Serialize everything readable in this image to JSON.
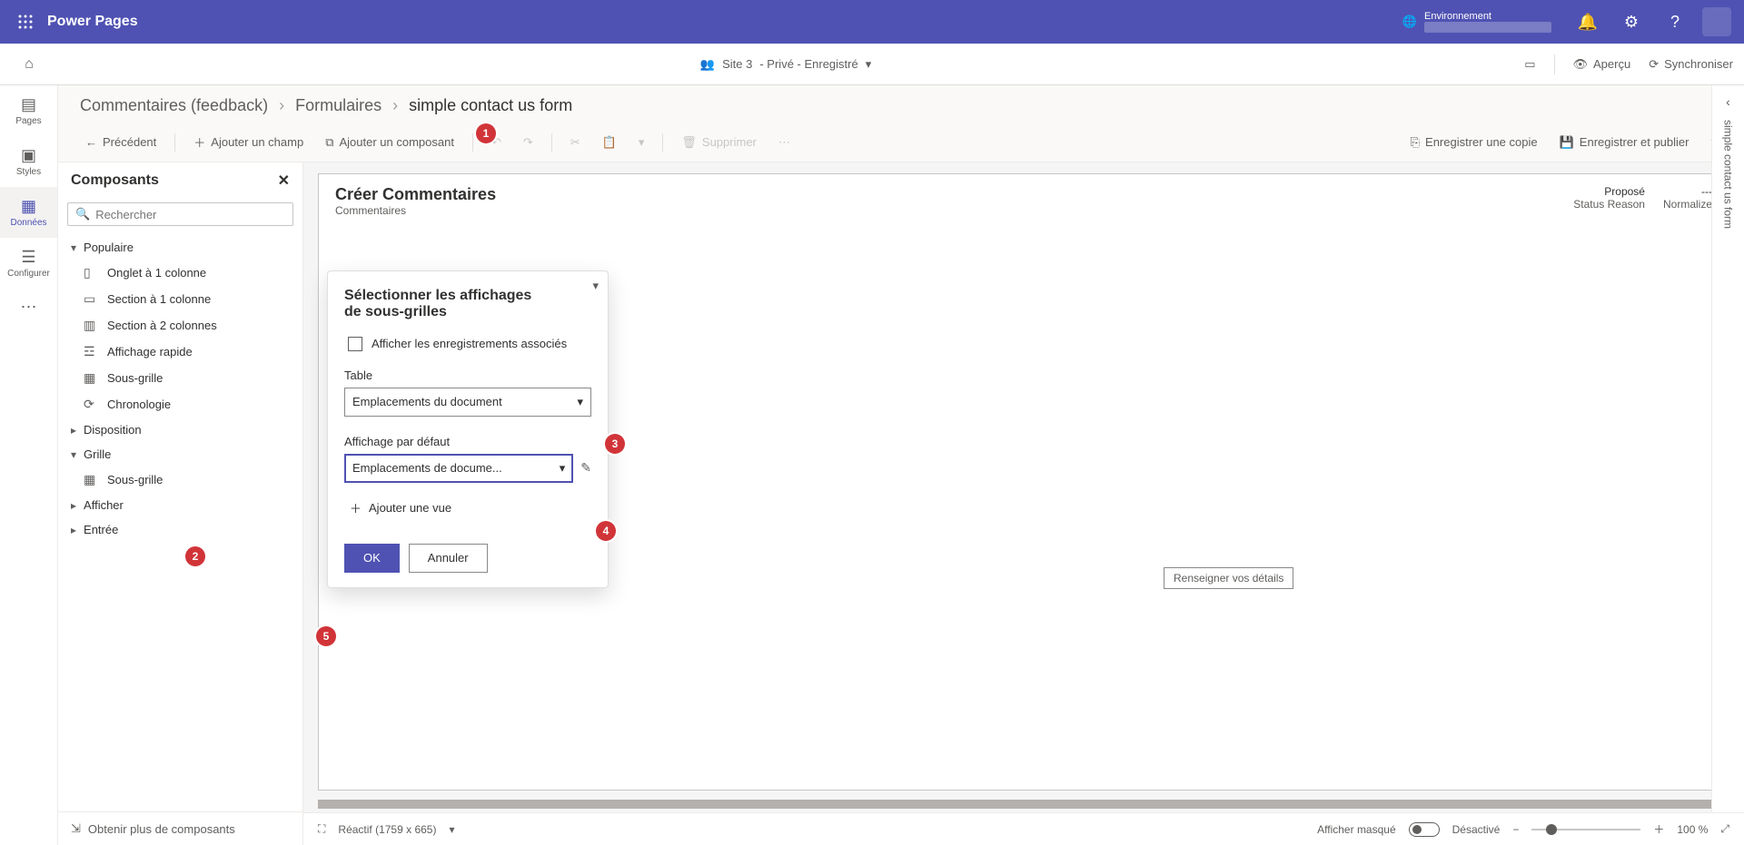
{
  "topbar": {
    "brand": "Power Pages",
    "env_label": "Environnement"
  },
  "secondbar": {
    "site_name": "Site 3",
    "site_status": "- Privé - Enregistré",
    "preview_label": "Aperçu",
    "sync_label": "Synchroniser"
  },
  "leftrail": {
    "pages_label": "Pages",
    "styles_label": "Styles",
    "data_label": "Données",
    "config_label": "Configurer"
  },
  "breadcrumb": {
    "level1": "Commentaires (feedback)",
    "level2": "Formulaires",
    "level3": "simple contact us form"
  },
  "toolbar": {
    "back_label": "Précédent",
    "add_field_label": "Ajouter un champ",
    "add_component_label": "Ajouter un composant",
    "delete_label": "Supprimer",
    "save_copy_label": "Enregistrer une copie",
    "save_publish_label": "Enregistrer et publier"
  },
  "components_panel": {
    "title": "Composants",
    "search_placeholder": "Rechercher",
    "groups": {
      "popular": "Populaire",
      "layout": "Disposition",
      "grid": "Grille",
      "display": "Afficher",
      "input": "Entrée"
    },
    "items": {
      "tab_1col": "Onglet à 1 colonne",
      "section_1col": "Section à 1 colonne",
      "section_2col": "Section à 2 colonnes",
      "quick_view": "Affichage rapide",
      "subgrid": "Sous-grille",
      "timeline": "Chronologie",
      "subgrid2": "Sous-grille"
    },
    "footer": "Obtenir plus de composants"
  },
  "canvas": {
    "title": "Créer Commentaires",
    "subtitle": "Commentaires",
    "status_col": {
      "value": "Proposé",
      "label": "Status Reason"
    },
    "normalize_col": {
      "value": "---",
      "label": "Normalize"
    },
    "placeholder": "Renseigner vos détails"
  },
  "popover": {
    "title_line1": "Sélectionner les affichages",
    "title_line2": "de sous-grilles",
    "related_records": "Afficher les enregistrements associés",
    "table_label": "Table",
    "table_value": "Emplacements du document",
    "default_view_label": "Affichage par défaut",
    "default_view_value": "Emplacements de docume...",
    "add_view_label": "Ajouter une vue",
    "ok_label": "OK",
    "cancel_label": "Annuler"
  },
  "statusbar": {
    "responsive_label": "Réactif (1759 x 665)",
    "show_hidden_label": "Afficher masqué",
    "toggle_state": "Désactivé",
    "zoom_value": "100 %"
  },
  "rightpanel": {
    "label": "simple contact us form"
  },
  "callouts": {
    "c1": "1",
    "c2": "2",
    "c3": "3",
    "c4": "4",
    "c5": "5"
  }
}
